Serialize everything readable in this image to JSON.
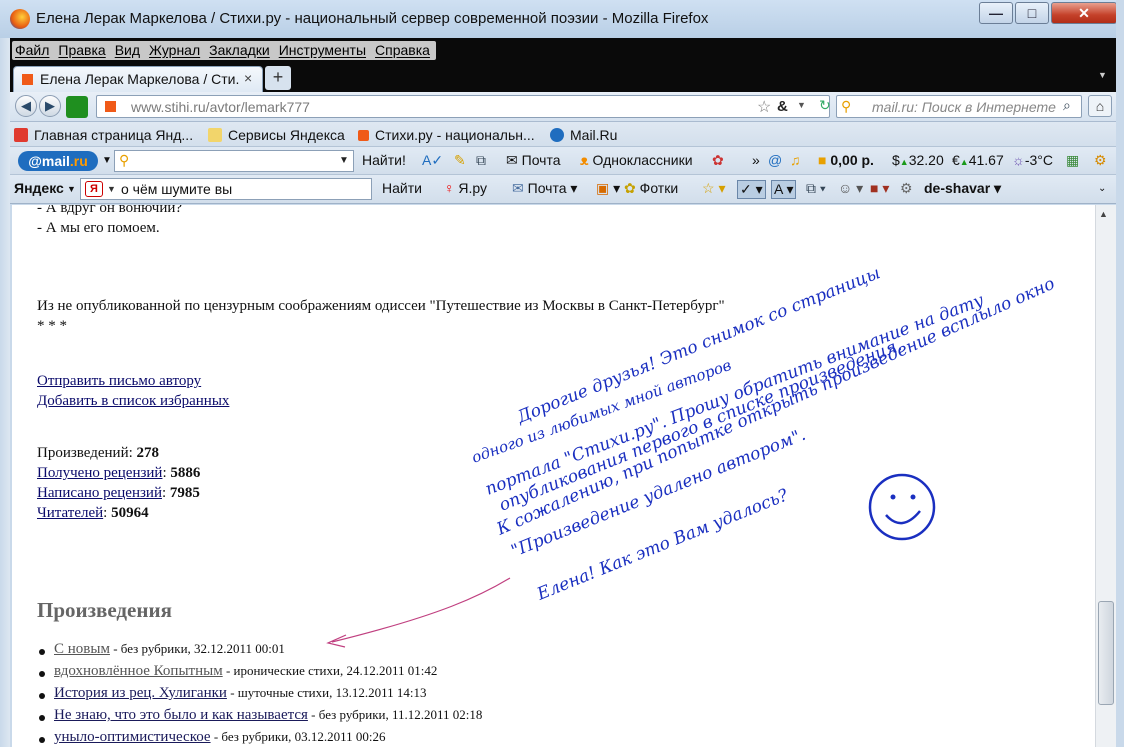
{
  "window": {
    "title": "Елена Лерак Маркелова / Стихи.ру - национальный сервер современной поэзии - Mozilla Firefox",
    "controls": {
      "minimize": "—",
      "maximize": "□",
      "close": "✕"
    }
  },
  "menu": [
    "Файл",
    "Правка",
    "Вид",
    "Журнал",
    "Закладки",
    "Инструменты",
    "Справка"
  ],
  "tab": {
    "title": "Елена Лерак Маркелова / Сти...",
    "close": "×",
    "new_tab": "+"
  },
  "nav": {
    "back": "◀",
    "forward": "▶",
    "url": "www.stihi.ru/avtor/lemark777",
    "search_placeholder": "mail.ru: Поиск в Интернете",
    "home": "⌂"
  },
  "bookmarks": [
    {
      "label": "Главная страница Янд...",
      "color": "#e03a2f"
    },
    {
      "label": "Сервисы Яндекса",
      "color": "#f2d56b"
    },
    {
      "label": "Стихи.ру - национальн...",
      "color": "#f05a18"
    },
    {
      "label": "Mail.Ru",
      "color": "#1f6dbf"
    }
  ],
  "mailru_toolbar": {
    "logo_text": "mail",
    "logo_suffix": ".ru",
    "search_button": "Найти!",
    "mail": "Почта",
    "odnoklassniki": "Одноклассники",
    "balance": "0,00 р.",
    "usd": "32.20",
    "eur": "41.67",
    "weather": "-3°C"
  },
  "yandex_toolbar": {
    "logo": "Яндекс",
    "query": "о чём шумите вы",
    "find": "Найти",
    "yaru": "Я.ру",
    "mail": "Почта",
    "photos": "Фотки",
    "user": "de-shavar"
  },
  "content": {
    "poem_tail": [
      "- А вдруг он вонючий?",
      "- А мы его помоем."
    ],
    "note": "Из не опубликованной по цензурным соображениям одиссеи \"Путешествие из Москвы в Санкт-Петербург\"",
    "stars": "* * *",
    "links": [
      "Отправить письмо автору",
      "Добавить в список избранных"
    ],
    "stats": [
      {
        "label": "Произведений",
        "value": "278",
        "link": false
      },
      {
        "label": "Получено рецензий",
        "value": "5886",
        "link": true
      },
      {
        "label": "Написано рецензий",
        "value": "7985",
        "link": true
      },
      {
        "label": "Читателей",
        "value": "50964",
        "link": true
      }
    ],
    "works_heading": "Произведения",
    "works": [
      {
        "title": "С новым",
        "meta": " - без рубрики, 32.12.2011 00:01",
        "color": "#555555"
      },
      {
        "title": "вдохновлённое Копытным",
        "meta": " - иронические стихи, 24.12.2011 01:42",
        "color": "#555555"
      },
      {
        "title": "История из рец. Хулиганки",
        "meta": " - шуточные стихи, 13.12.2011 14:13",
        "color": "#1a1a5a"
      },
      {
        "title": "Не знаю, что это было и как называется",
        "meta": " - без рубрики, 11.12.2011 02:18",
        "color": "#1a1a5a"
      },
      {
        "title": "уныло-оптимистическое",
        "meta": " - без рубрики, 03.12.2011 00:26",
        "color": "#1a1a5a"
      }
    ]
  },
  "annotation": {
    "lines": [
      "Дорогие друзья! Это снимок со страницы",
      "одного из любимых мной авторов",
      "портала \"Стихи.ру\". Прошу обратить внимание на дату",
      "опубликования первого в списке произведения.",
      "К сожалению, при попытке открыть произведение всплыло окно",
      "\"Произведение удалено автором\".",
      "Елена! Как это Вам удалось?"
    ],
    "ink_color": "#1a2fc0"
  }
}
